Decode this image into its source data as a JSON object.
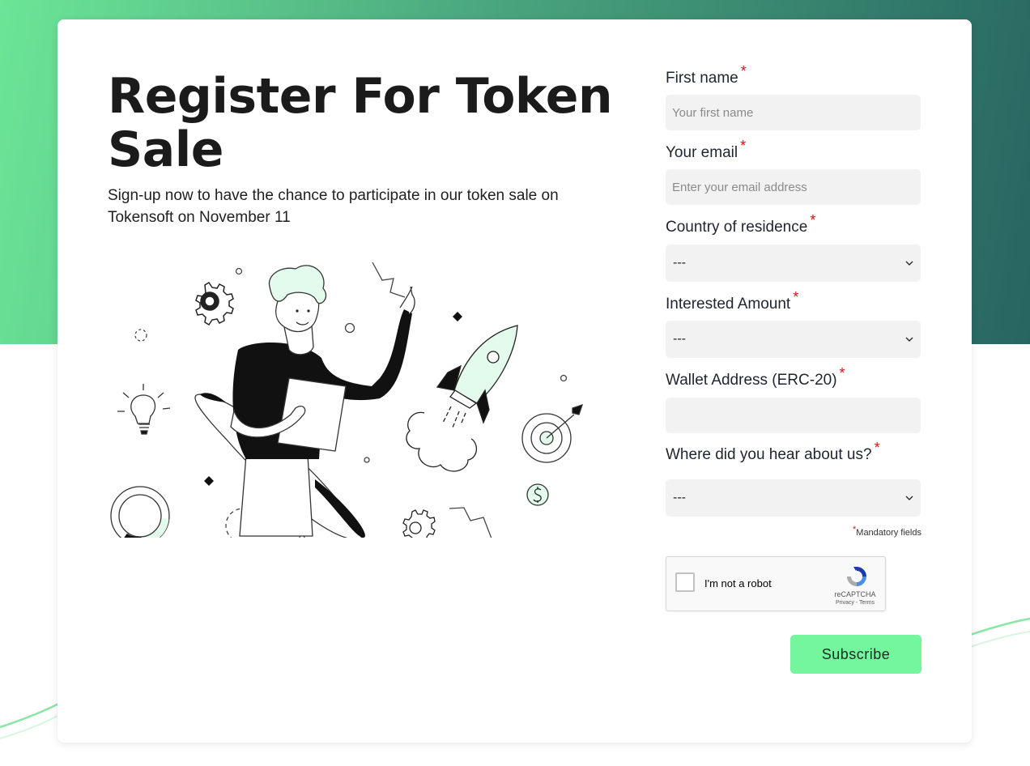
{
  "hero": {
    "title": "Register For Token Sale",
    "subtitle": "Sign-up now to have the chance to participate in our token sale on Tokensoft on November 11"
  },
  "form": {
    "required_marker": "*",
    "first_name": {
      "label": "First name",
      "placeholder": "Your first name",
      "value": ""
    },
    "email": {
      "label": "Your email",
      "placeholder": "Enter your email address",
      "value": ""
    },
    "country": {
      "label": "Country of residence",
      "selected": "---"
    },
    "amount": {
      "label": "Interested Amount",
      "selected": "---"
    },
    "wallet": {
      "label": "Wallet Address (ERC-20)",
      "placeholder": "",
      "value": ""
    },
    "source": {
      "label": "Where did you hear about us?",
      "selected": "---"
    },
    "mandatory_note": "Mandatory fields",
    "captcha": {
      "checkbox_label": "I'm not a robot",
      "brand": "reCAPTCHA",
      "links": "Privacy - Terms"
    },
    "submit_label": "Subscribe"
  },
  "colors": {
    "gradient_start": "#6ce597",
    "gradient_end": "#276561",
    "accent_mint": "#e3fbec",
    "button": "#74f79c",
    "required": "#d01414"
  },
  "icons": [
    "gear-icon",
    "lightbulb-icon",
    "rocket-icon",
    "target-icon",
    "dollar-icon",
    "donut-chart-icon",
    "recaptcha-icon",
    "chevron-down-icon"
  ]
}
